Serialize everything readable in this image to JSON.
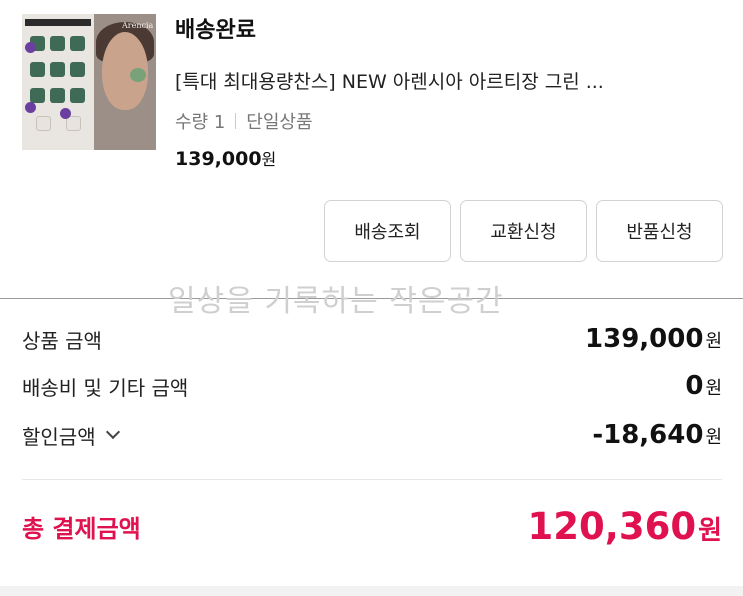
{
  "order": {
    "status": "배송완료",
    "product_title": "[특대 최대용량찬스] NEW 아렌시아 아르티장 그린 ...",
    "quantity": "수량 1",
    "option": "단일상품",
    "price": "139,000",
    "currency": "원",
    "thumbnail_brand": "Arencia"
  },
  "actions": {
    "tracking": "배송조회",
    "exchange": "교환신청",
    "return": "반품신청"
  },
  "watermark": "일상을 기록하는 작은공간",
  "summary": {
    "product_amount_label": "상품 금액",
    "product_amount": "139,000",
    "shipping_label": "배송비 및 기타 금액",
    "shipping_amount": "0",
    "discount_label": "할인금액",
    "discount_amount": "-18,640",
    "currency": "원"
  },
  "total": {
    "label": "총 결제금액",
    "amount": "120,360",
    "currency": "원"
  },
  "colors": {
    "accent": "#e0114f",
    "text": "#111111",
    "muted": "#777777",
    "border": "#d2d2d2"
  }
}
